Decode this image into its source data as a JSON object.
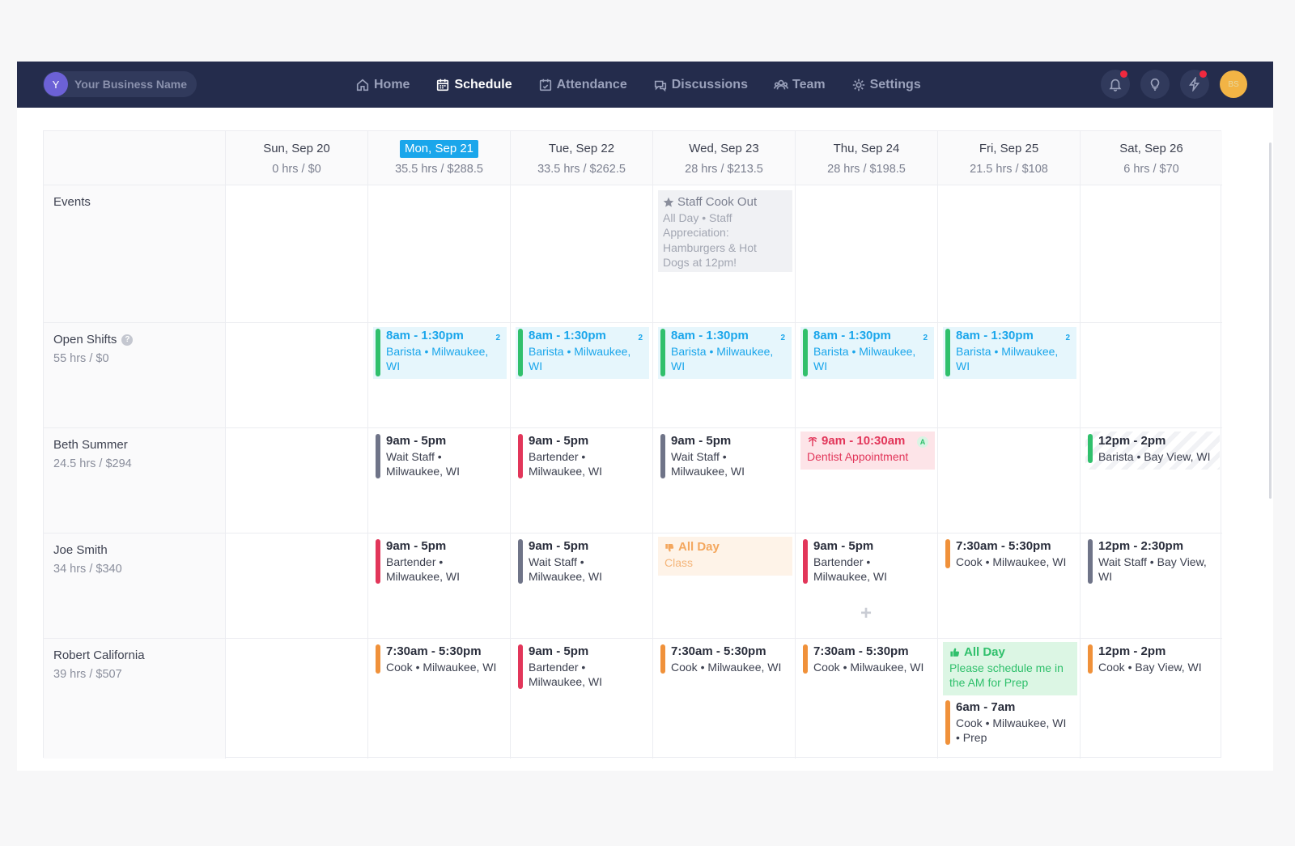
{
  "business": {
    "initial": "Y",
    "name": "Your Business Name"
  },
  "nav": [
    {
      "label": "Home",
      "icon": "home-icon"
    },
    {
      "label": "Schedule",
      "icon": "calendar-icon",
      "active": true
    },
    {
      "label": "Attendance",
      "icon": "calendar-check-icon"
    },
    {
      "label": "Discussions",
      "icon": "chat-icon"
    },
    {
      "label": "Team",
      "icon": "team-icon"
    },
    {
      "label": "Settings",
      "icon": "gear-icon"
    }
  ],
  "topbar_icons": [
    "bell-icon",
    "lightbulb-icon",
    "lightning-icon"
  ],
  "user_avatar": {
    "initials": "BS"
  },
  "days": [
    {
      "name": "Sun, Sep 20",
      "stats": "0 hrs / $0"
    },
    {
      "name": "Mon, Sep 21",
      "stats": "35.5 hrs / $288.5",
      "today": true
    },
    {
      "name": "Tue, Sep 22",
      "stats": "33.5 hrs / $262.5"
    },
    {
      "name": "Wed, Sep 23",
      "stats": "28 hrs / $213.5"
    },
    {
      "name": "Thu, Sep 24",
      "stats": "28 hrs / $198.5"
    },
    {
      "name": "Fri, Sep 25",
      "stats": "21.5 hrs / $108"
    },
    {
      "name": "Sat, Sep 26",
      "stats": "6 hrs / $70"
    }
  ],
  "events_row": {
    "label": "Events",
    "event": {
      "title": "Staff Cook Out",
      "l1": "All Day • Staff",
      "l2": "Appreciation:",
      "l3": "Hamburgers & Hot",
      "l4": "Dogs at 12pm!"
    }
  },
  "open_shifts": {
    "label": "Open Shifts",
    "stats": "55 hrs / $0",
    "shift": {
      "time": "8am - 1:30pm",
      "l1": "Barista • Milwaukee,",
      "l2": "WI",
      "count": "2"
    }
  },
  "employees": [
    {
      "name": "Beth Summer",
      "stats": "24.5 hrs / $294",
      "mon": {
        "time": "9am - 5pm",
        "l1": "Wait Staff •",
        "l2": "Milwaukee, WI"
      },
      "tue": {
        "time": "9am - 5pm",
        "l1": "Bartender •",
        "l2": "Milwaukee, WI"
      },
      "wed": {
        "time": "9am - 5pm",
        "l1": "Wait Staff •",
        "l2": "Milwaukee, WI"
      },
      "thu": {
        "time": "9am - 10:30am",
        "l1": "Dentist Appointment",
        "badge": "A"
      },
      "sat": {
        "time": "12pm - 2pm",
        "l1": "Barista • Bay View, WI"
      }
    },
    {
      "name": "Joe Smith",
      "stats": "34 hrs / $340",
      "mon": {
        "time": "9am - 5pm",
        "l1": "Bartender •",
        "l2": "Milwaukee, WI"
      },
      "tue": {
        "time": "9am - 5pm",
        "l1": "Wait Staff •",
        "l2": "Milwaukee, WI"
      },
      "wed": {
        "time": "All Day",
        "l1": "Class"
      },
      "thu": {
        "time": "9am - 5pm",
        "l1": "Bartender •",
        "l2": "Milwaukee, WI"
      },
      "fri": {
        "time": "7:30am - 5:30pm",
        "l1": "Cook • Milwaukee, WI"
      },
      "sat": {
        "time": "12pm - 2:30pm",
        "l1": "Wait Staff • Bay View,",
        "l2": "WI"
      }
    },
    {
      "name": "Robert California",
      "stats": "39 hrs / $507",
      "mon": {
        "time": "7:30am - 5:30pm",
        "l1": "Cook • Milwaukee, WI"
      },
      "tue": {
        "time": "9am - 5pm",
        "l1": "Bartender •",
        "l2": "Milwaukee, WI"
      },
      "wed": {
        "time": "7:30am - 5:30pm",
        "l1": "Cook • Milwaukee, WI"
      },
      "thu": {
        "time": "7:30am - 5:30pm",
        "l1": "Cook • Milwaukee, WI"
      },
      "fri_pref": {
        "time": "All Day",
        "l1": "Please schedule me in",
        "l2": "the AM for Prep"
      },
      "fri": {
        "time": "6am - 7am",
        "l1": "Cook • Milwaukee, WI",
        "l2": "• Prep"
      },
      "sat": {
        "time": "12pm - 2pm",
        "l1": "Cook • Bay View, WI"
      }
    }
  ],
  "colors": {
    "topbar": "#242c4c",
    "accent": "#1aa6eb",
    "red": "#e2365a",
    "orange": "#f0913a",
    "green": "#30c06c",
    "gray": "#6f7488"
  }
}
